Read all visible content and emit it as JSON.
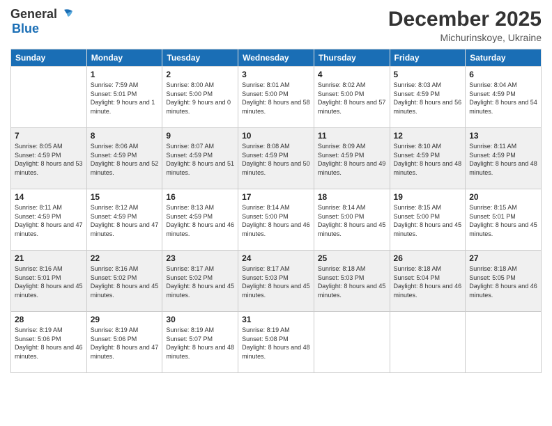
{
  "header": {
    "logo_line1": "General",
    "logo_line2": "Blue",
    "month": "December 2025",
    "location": "Michurinskoye, Ukraine"
  },
  "days_of_week": [
    "Sunday",
    "Monday",
    "Tuesday",
    "Wednesday",
    "Thursday",
    "Friday",
    "Saturday"
  ],
  "weeks": [
    [
      {
        "day": "",
        "sunrise": "",
        "sunset": "",
        "daylight": ""
      },
      {
        "day": "1",
        "sunrise": "Sunrise: 7:59 AM",
        "sunset": "Sunset: 5:01 PM",
        "daylight": "Daylight: 9 hours and 1 minute."
      },
      {
        "day": "2",
        "sunrise": "Sunrise: 8:00 AM",
        "sunset": "Sunset: 5:00 PM",
        "daylight": "Daylight: 9 hours and 0 minutes."
      },
      {
        "day": "3",
        "sunrise": "Sunrise: 8:01 AM",
        "sunset": "Sunset: 5:00 PM",
        "daylight": "Daylight: 8 hours and 58 minutes."
      },
      {
        "day": "4",
        "sunrise": "Sunrise: 8:02 AM",
        "sunset": "Sunset: 5:00 PM",
        "daylight": "Daylight: 8 hours and 57 minutes."
      },
      {
        "day": "5",
        "sunrise": "Sunrise: 8:03 AM",
        "sunset": "Sunset: 4:59 PM",
        "daylight": "Daylight: 8 hours and 56 minutes."
      },
      {
        "day": "6",
        "sunrise": "Sunrise: 8:04 AM",
        "sunset": "Sunset: 4:59 PM",
        "daylight": "Daylight: 8 hours and 54 minutes."
      }
    ],
    [
      {
        "day": "7",
        "sunrise": "Sunrise: 8:05 AM",
        "sunset": "Sunset: 4:59 PM",
        "daylight": "Daylight: 8 hours and 53 minutes."
      },
      {
        "day": "8",
        "sunrise": "Sunrise: 8:06 AM",
        "sunset": "Sunset: 4:59 PM",
        "daylight": "Daylight: 8 hours and 52 minutes."
      },
      {
        "day": "9",
        "sunrise": "Sunrise: 8:07 AM",
        "sunset": "Sunset: 4:59 PM",
        "daylight": "Daylight: 8 hours and 51 minutes."
      },
      {
        "day": "10",
        "sunrise": "Sunrise: 8:08 AM",
        "sunset": "Sunset: 4:59 PM",
        "daylight": "Daylight: 8 hours and 50 minutes."
      },
      {
        "day": "11",
        "sunrise": "Sunrise: 8:09 AM",
        "sunset": "Sunset: 4:59 PM",
        "daylight": "Daylight: 8 hours and 49 minutes."
      },
      {
        "day": "12",
        "sunrise": "Sunrise: 8:10 AM",
        "sunset": "Sunset: 4:59 PM",
        "daylight": "Daylight: 8 hours and 48 minutes."
      },
      {
        "day": "13",
        "sunrise": "Sunrise: 8:11 AM",
        "sunset": "Sunset: 4:59 PM",
        "daylight": "Daylight: 8 hours and 48 minutes."
      }
    ],
    [
      {
        "day": "14",
        "sunrise": "Sunrise: 8:11 AM",
        "sunset": "Sunset: 4:59 PM",
        "daylight": "Daylight: 8 hours and 47 minutes."
      },
      {
        "day": "15",
        "sunrise": "Sunrise: 8:12 AM",
        "sunset": "Sunset: 4:59 PM",
        "daylight": "Daylight: 8 hours and 47 minutes."
      },
      {
        "day": "16",
        "sunrise": "Sunrise: 8:13 AM",
        "sunset": "Sunset: 4:59 PM",
        "daylight": "Daylight: 8 hours and 46 minutes."
      },
      {
        "day": "17",
        "sunrise": "Sunrise: 8:14 AM",
        "sunset": "Sunset: 5:00 PM",
        "daylight": "Daylight: 8 hours and 46 minutes."
      },
      {
        "day": "18",
        "sunrise": "Sunrise: 8:14 AM",
        "sunset": "Sunset: 5:00 PM",
        "daylight": "Daylight: 8 hours and 45 minutes."
      },
      {
        "day": "19",
        "sunrise": "Sunrise: 8:15 AM",
        "sunset": "Sunset: 5:00 PM",
        "daylight": "Daylight: 8 hours and 45 minutes."
      },
      {
        "day": "20",
        "sunrise": "Sunrise: 8:15 AM",
        "sunset": "Sunset: 5:01 PM",
        "daylight": "Daylight: 8 hours and 45 minutes."
      }
    ],
    [
      {
        "day": "21",
        "sunrise": "Sunrise: 8:16 AM",
        "sunset": "Sunset: 5:01 PM",
        "daylight": "Daylight: 8 hours and 45 minutes."
      },
      {
        "day": "22",
        "sunrise": "Sunrise: 8:16 AM",
        "sunset": "Sunset: 5:02 PM",
        "daylight": "Daylight: 8 hours and 45 minutes."
      },
      {
        "day": "23",
        "sunrise": "Sunrise: 8:17 AM",
        "sunset": "Sunset: 5:02 PM",
        "daylight": "Daylight: 8 hours and 45 minutes."
      },
      {
        "day": "24",
        "sunrise": "Sunrise: 8:17 AM",
        "sunset": "Sunset: 5:03 PM",
        "daylight": "Daylight: 8 hours and 45 minutes."
      },
      {
        "day": "25",
        "sunrise": "Sunrise: 8:18 AM",
        "sunset": "Sunset: 5:03 PM",
        "daylight": "Daylight: 8 hours and 45 minutes."
      },
      {
        "day": "26",
        "sunrise": "Sunrise: 8:18 AM",
        "sunset": "Sunset: 5:04 PM",
        "daylight": "Daylight: 8 hours and 46 minutes."
      },
      {
        "day": "27",
        "sunrise": "Sunrise: 8:18 AM",
        "sunset": "Sunset: 5:05 PM",
        "daylight": "Daylight: 8 hours and 46 minutes."
      }
    ],
    [
      {
        "day": "28",
        "sunrise": "Sunrise: 8:19 AM",
        "sunset": "Sunset: 5:06 PM",
        "daylight": "Daylight: 8 hours and 46 minutes."
      },
      {
        "day": "29",
        "sunrise": "Sunrise: 8:19 AM",
        "sunset": "Sunset: 5:06 PM",
        "daylight": "Daylight: 8 hours and 47 minutes."
      },
      {
        "day": "30",
        "sunrise": "Sunrise: 8:19 AM",
        "sunset": "Sunset: 5:07 PM",
        "daylight": "Daylight: 8 hours and 48 minutes."
      },
      {
        "day": "31",
        "sunrise": "Sunrise: 8:19 AM",
        "sunset": "Sunset: 5:08 PM",
        "daylight": "Daylight: 8 hours and 48 minutes."
      },
      {
        "day": "",
        "sunrise": "",
        "sunset": "",
        "daylight": ""
      },
      {
        "day": "",
        "sunrise": "",
        "sunset": "",
        "daylight": ""
      },
      {
        "day": "",
        "sunrise": "",
        "sunset": "",
        "daylight": ""
      }
    ]
  ]
}
